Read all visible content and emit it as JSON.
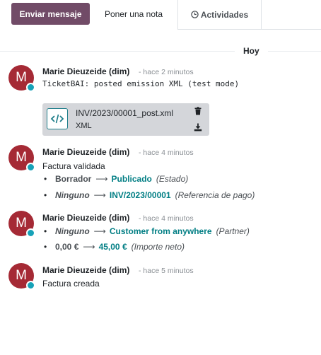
{
  "toolbar": {
    "send_label": "Enviar mensaje",
    "note_label": "Poner una nota",
    "activities_label": "Actividades",
    "accent_color": "#714b67"
  },
  "day_separator": "Hoy",
  "messages": [
    {
      "author": "Marie Dieuzeide (dim)",
      "time": "- hace 2 minutos",
      "avatar_letter": "M",
      "body": "TicketBAI: posted emission XML (test mode)",
      "attachment": {
        "name": "INV/2023/00001_post.xml",
        "type": "XML",
        "icon": "code-file-icon"
      }
    },
    {
      "author": "Marie Dieuzeide (dim)",
      "time": "- hace 4 minutos",
      "avatar_letter": "M",
      "body": "Factura validada",
      "tracking": [
        {
          "old": "Borrador",
          "new": "Publicado",
          "field": "(Estado)"
        },
        {
          "old": "Ninguno",
          "new": "INV/2023/00001",
          "field": "(Referencia de pago)"
        }
      ]
    },
    {
      "author": "Marie Dieuzeide (dim)",
      "time": "- hace 4 minutos",
      "avatar_letter": "M",
      "tracking": [
        {
          "old": "Ninguno",
          "new": "Customer from anywhere",
          "field": "(Partner)"
        },
        {
          "old": "0,00 €",
          "new": "45,00 €",
          "field": "(Importe neto)"
        }
      ]
    },
    {
      "author": "Marie Dieuzeide (dim)",
      "time": "- hace 5 minutos",
      "avatar_letter": "M",
      "body": "Factura creada"
    }
  ],
  "arrow_glyph": "⟶",
  "bullet_glyph": "•"
}
